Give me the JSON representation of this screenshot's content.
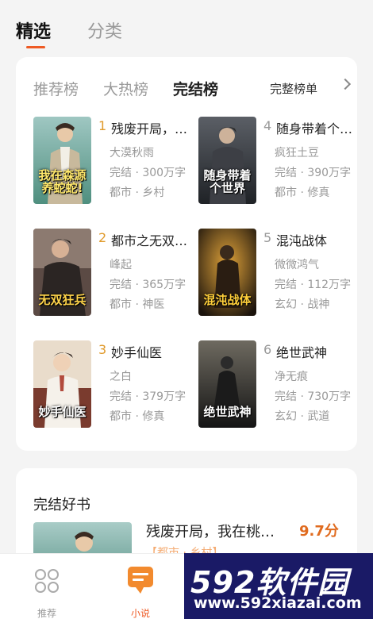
{
  "top_tabs": {
    "active": "精选",
    "inactive": "分类"
  },
  "rank_tabs": [
    "推荐榜",
    "大热榜",
    "完结榜"
  ],
  "full_list_label": "完整榜单",
  "books": [
    {
      "rank": "1",
      "title": "残废开局，…",
      "author": "大漠秋雨",
      "status": "完结 · 300万字",
      "tags": "都市 · 乡村",
      "cover_text": "我在森源养蛇蛇!"
    },
    {
      "rank": "2",
      "title": "都市之无双…",
      "author": "峰起",
      "status": "完结 · 365万字",
      "tags": "都市 · 神医",
      "cover_text": "无双狂兵"
    },
    {
      "rank": "3",
      "title": "妙手仙医",
      "author": "之白",
      "status": "完结 · 379万字",
      "tags": "都市 · 修真",
      "cover_text": "妙手仙医"
    },
    {
      "rank": "4",
      "title": "随身带着个…",
      "author": "疯狂土豆",
      "status": "完结 · 390万字",
      "tags": "都市 · 修真",
      "cover_text": "随身带着个世界"
    },
    {
      "rank": "5",
      "title": "混沌战体",
      "author": "微微鸿气",
      "status": "完结 · 112万字",
      "tags": "玄幻 · 战神",
      "cover_text": "混沌战体"
    },
    {
      "rank": "6",
      "title": "绝世武神",
      "author": "净无痕",
      "status": "完结 · 730万字",
      "tags": "玄幻 · 武道",
      "cover_text": "绝世武神"
    }
  ],
  "section2": {
    "title": "完结好书",
    "book_title": "残废开局，我在桃…",
    "score": "9.7分",
    "sub": "【都市 · 乡村】…"
  },
  "nav": [
    {
      "label": "推荐",
      "icon": "grid-icon"
    },
    {
      "label": "小说",
      "icon": "book-chat-icon"
    }
  ],
  "watermark": {
    "logo": "592软件园",
    "url": "www.592xiazai.com"
  },
  "colors": {
    "accent": "#ee5a24",
    "rank_top": "#e09a2b",
    "score": "#e06b1f"
  }
}
